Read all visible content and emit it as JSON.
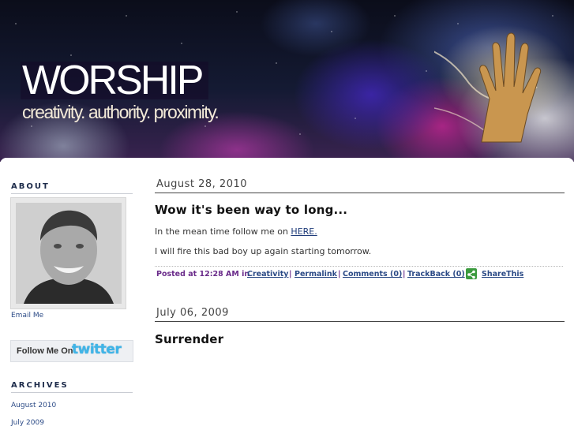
{
  "header": {
    "title": "WORSHIP",
    "tagline": "creativity. authority. proximity."
  },
  "sidebar": {
    "about_heading": "ABOUT",
    "email_link": "Email Me",
    "twitter_badge": {
      "prefix": "Follow Me On",
      "brand": "twitter"
    },
    "archives_heading": "ARCHIVES",
    "archives": [
      "August 2010",
      "July 2009"
    ]
  },
  "posts": [
    {
      "date": "August 28, 2010",
      "title": "Wow it's been way to long...",
      "paragraph1_prefix": "In the mean time follow me on ",
      "paragraph1_link": "HERE.",
      "paragraph2": "I will fire this bad boy up again starting tomorrow.",
      "footer": {
        "posted_prefix": "Posted at 12:28 AM in ",
        "category": "Creativity",
        "permalink": "Permalink",
        "comments": "Comments (0)",
        "trackback": "TrackBack (0)",
        "share": "ShareThis",
        "separator": "|"
      }
    },
    {
      "date": "July 06, 2009",
      "title": "Surrender"
    }
  ],
  "colors": {
    "heading": "#1d2b4a",
    "link": "#2b4a86",
    "footer_text": "#6a2b8a",
    "share_icon": "#3b9a3e",
    "twitter_brand": "#3fb5e8"
  }
}
